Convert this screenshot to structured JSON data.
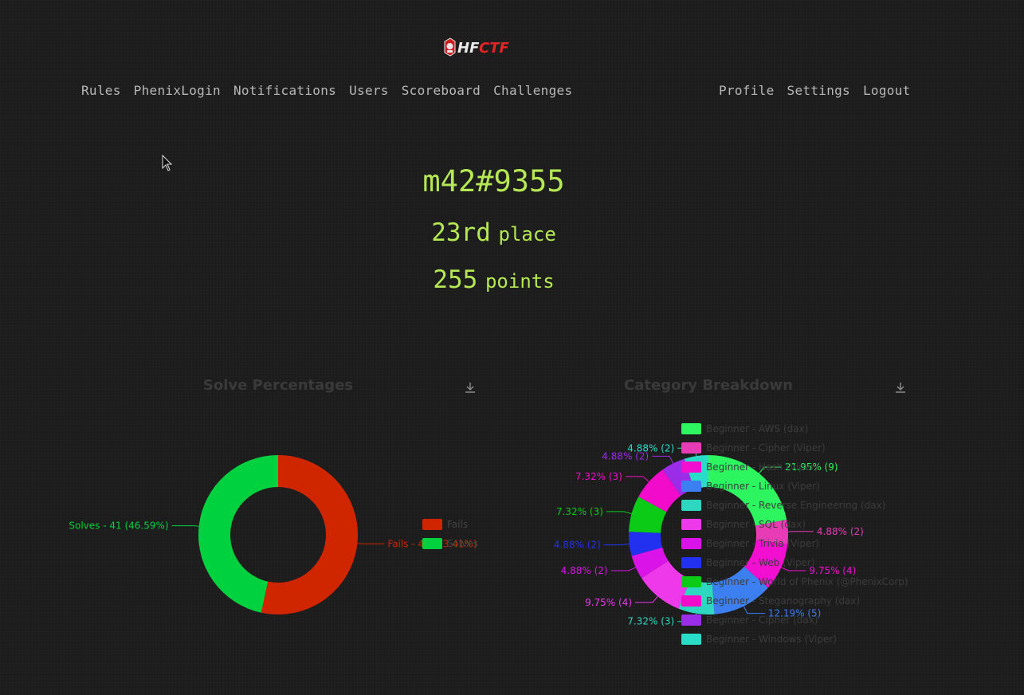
{
  "logo": {
    "text": "HFCTF"
  },
  "nav": {
    "left": [
      "Rules",
      "PhenixLogin",
      "Notifications",
      "Users",
      "Scoreboard",
      "Challenges"
    ],
    "right": [
      "Profile",
      "Settings",
      "Logout"
    ]
  },
  "profile": {
    "name": "m42#9355",
    "place_num": "23rd",
    "place_unit": "place",
    "points_num": "255",
    "points_unit": "points"
  },
  "chart_data": [
    {
      "type": "pie",
      "title": "Solve Percentages",
      "categories": [
        "Fails",
        "Solves"
      ],
      "values": [
        47,
        41
      ],
      "labels": [
        "Fails - 47 (53.41%)",
        "Solves - 41 (46.59%)"
      ],
      "colors": [
        "#cf2600",
        "#00d13f"
      ],
      "legend": "right"
    },
    {
      "type": "pie",
      "title": "Category Breakdown",
      "categories": [
        "Beginner - AWS (dax)",
        "Beginner - Cipher (Viper)",
        "Beginner - Hash (Viper)",
        "Beginner - Linux (Viper)",
        "Beginner - Reverse Engineering (dax)",
        "Beginner - SQL (dax)",
        "Beginner - Trivia (Viper)",
        "Beginner - Web (Viper)",
        "Beginner - World of Phenix (@PhenixCorp)",
        "Beginner - Steganography (dax)",
        "Beginner - Cipher (dax)",
        "Beginner - Windows (Viper)"
      ],
      "values": [
        9,
        2,
        4,
        5,
        3,
        4,
        2,
        2,
        3,
        3,
        2,
        2
      ],
      "labels": [
        "21.95% (9)",
        "4.88% (2)",
        "9.75% (4)",
        "12.19% (5)",
        "7.32% (3)",
        "9.75% (4)",
        "4.88% (2)",
        "4.88% (2)",
        "7.32% (3)",
        "7.32% (3)",
        "4.88% (2)",
        "4.88% (2)"
      ],
      "colors": [
        "#2cf560",
        "#e83cb6",
        "#f20fcf",
        "#3c7ff0",
        "#2ed8c0",
        "#ee39ea",
        "#da13e8",
        "#2131ef",
        "#0ccb17",
        "#f20bca",
        "#9b2ce8",
        "#29dcc7"
      ],
      "legend": "center"
    }
  ]
}
